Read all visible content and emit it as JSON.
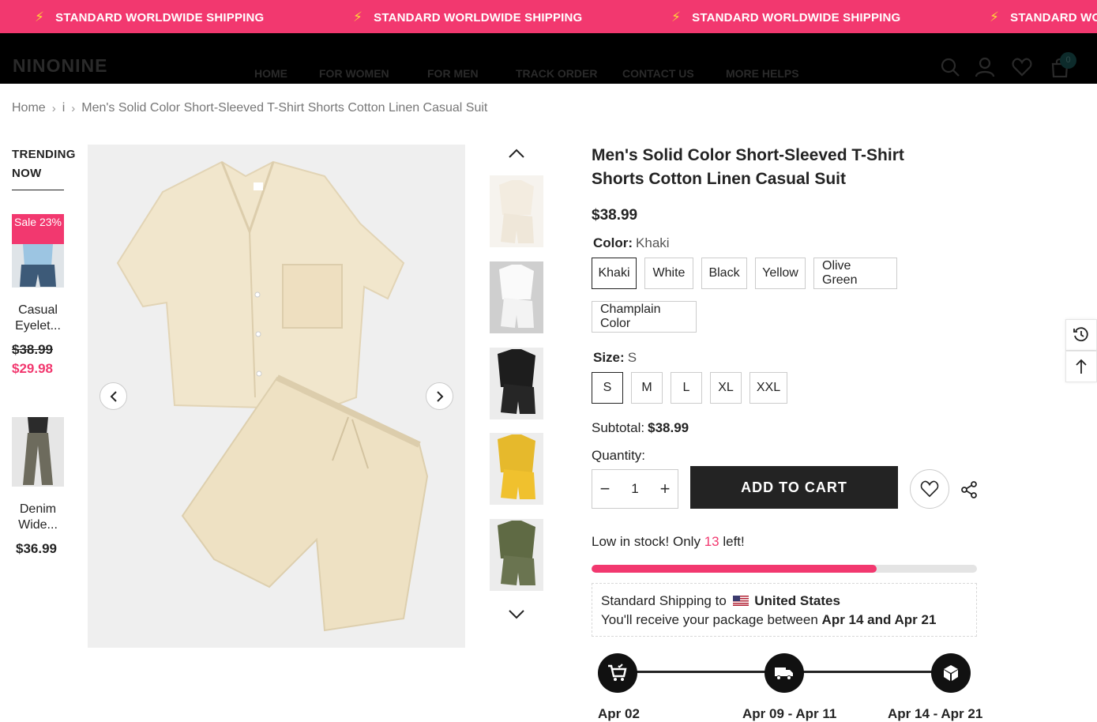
{
  "announcement": {
    "items": [
      "STANDARD WORLDWIDE SHIPPING",
      "STANDARD WORLDWIDE SHIPPING",
      "STANDARD WORLDWIDE SHIPPING",
      "STANDARD WORLDWIDE SHIPPING"
    ],
    "icon": "lightning-icon",
    "bg_color": "#f2386f"
  },
  "header": {
    "logo": "NINONINE",
    "nav": [
      "HOME",
      " FOR WOMEN",
      " FOR MEN",
      "TRACK ORDER",
      "CONTACT US",
      "MORE HELPS"
    ],
    "cart_count": "0",
    "icons": [
      "search-icon",
      "account-icon",
      "wishlist-icon",
      "cart-icon"
    ]
  },
  "breadcrumb": {
    "home": "Home",
    "middle": "i",
    "current": "Men's Solid Color Short-Sleeved T-Shirt Shorts Cotton Linen Casual Suit"
  },
  "trending": {
    "title": "TRENDING NOW ",
    "products": [
      {
        "badge": "Sale 23%",
        "name": "Casual Eyelet...",
        "old_price": "$38.99",
        "price": "$29.98"
      },
      {
        "name": "Denim Wide...",
        "price": "$36.99"
      }
    ]
  },
  "product": {
    "title": "Men's Solid Color Short-Sleeved T-Shirt Shorts Cotton Linen Casual Suit",
    "price": "$38.99",
    "color_label": "Color:",
    "color_value": "Khaki",
    "colors": [
      "Khaki",
      "White",
      "Black",
      "Yellow",
      "Olive Green",
      "Champlain Color"
    ],
    "size_label": "Size:",
    "size_value": "S",
    "sizes": [
      "S",
      "M",
      "L",
      "XL",
      "XXL"
    ],
    "subtotal_label": "Subtotal:",
    "subtotal_value": "$38.99",
    "quantity_label": "Quantity:",
    "quantity": "1",
    "add_to_cart": "ADD TO CART",
    "stock_prefix": " Low in stock! Only",
    "stock_count": "13",
    "stock_suffix": "left!",
    "stock_level": 0.74,
    "shipping_line1_prefix": " Standard Shipping to",
    "shipping_country": "United States",
    "shipping_line2_prefix": " You'll receive your package between",
    "shipping_dates": "Apr 14 and Apr 21",
    "timeline_dates": [
      "Apr 02",
      "Apr 09 - Apr 11",
      "Apr 14 - Apr 21"
    ],
    "accent_color": "#f2386f"
  },
  "side_tools": [
    "recently-viewed-icon",
    "back-to-top-icon"
  ]
}
